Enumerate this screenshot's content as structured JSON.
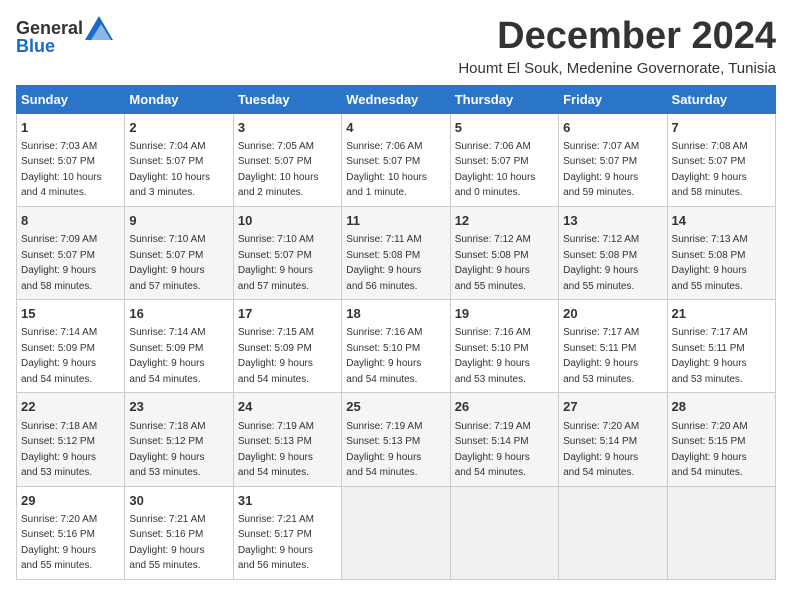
{
  "logo": {
    "general": "General",
    "blue": "Blue"
  },
  "title": "December 2024",
  "subtitle": "Houmt El Souk, Medenine Governorate, Tunisia",
  "days_of_week": [
    "Sunday",
    "Monday",
    "Tuesday",
    "Wednesday",
    "Thursday",
    "Friday",
    "Saturday"
  ],
  "weeks": [
    [
      {
        "num": "1",
        "sunrise": "7:03 AM",
        "sunset": "5:07 PM",
        "daylight": "10 hours and 4 minutes."
      },
      {
        "num": "2",
        "sunrise": "7:04 AM",
        "sunset": "5:07 PM",
        "daylight": "10 hours and 3 minutes."
      },
      {
        "num": "3",
        "sunrise": "7:05 AM",
        "sunset": "5:07 PM",
        "daylight": "10 hours and 2 minutes."
      },
      {
        "num": "4",
        "sunrise": "7:06 AM",
        "sunset": "5:07 PM",
        "daylight": "10 hours and 1 minute."
      },
      {
        "num": "5",
        "sunrise": "7:06 AM",
        "sunset": "5:07 PM",
        "daylight": "10 hours and 0 minutes."
      },
      {
        "num": "6",
        "sunrise": "7:07 AM",
        "sunset": "5:07 PM",
        "daylight": "9 hours and 59 minutes."
      },
      {
        "num": "7",
        "sunrise": "7:08 AM",
        "sunset": "5:07 PM",
        "daylight": "9 hours and 58 minutes."
      }
    ],
    [
      {
        "num": "8",
        "sunrise": "7:09 AM",
        "sunset": "5:07 PM",
        "daylight": "9 hours and 58 minutes."
      },
      {
        "num": "9",
        "sunrise": "7:10 AM",
        "sunset": "5:07 PM",
        "daylight": "9 hours and 57 minutes."
      },
      {
        "num": "10",
        "sunrise": "7:10 AM",
        "sunset": "5:07 PM",
        "daylight": "9 hours and 57 minutes."
      },
      {
        "num": "11",
        "sunrise": "7:11 AM",
        "sunset": "5:08 PM",
        "daylight": "9 hours and 56 minutes."
      },
      {
        "num": "12",
        "sunrise": "7:12 AM",
        "sunset": "5:08 PM",
        "daylight": "9 hours and 55 minutes."
      },
      {
        "num": "13",
        "sunrise": "7:12 AM",
        "sunset": "5:08 PM",
        "daylight": "9 hours and 55 minutes."
      },
      {
        "num": "14",
        "sunrise": "7:13 AM",
        "sunset": "5:08 PM",
        "daylight": "9 hours and 55 minutes."
      }
    ],
    [
      {
        "num": "15",
        "sunrise": "7:14 AM",
        "sunset": "5:09 PM",
        "daylight": "9 hours and 54 minutes."
      },
      {
        "num": "16",
        "sunrise": "7:14 AM",
        "sunset": "5:09 PM",
        "daylight": "9 hours and 54 minutes."
      },
      {
        "num": "17",
        "sunrise": "7:15 AM",
        "sunset": "5:09 PM",
        "daylight": "9 hours and 54 minutes."
      },
      {
        "num": "18",
        "sunrise": "7:16 AM",
        "sunset": "5:10 PM",
        "daylight": "9 hours and 54 minutes."
      },
      {
        "num": "19",
        "sunrise": "7:16 AM",
        "sunset": "5:10 PM",
        "daylight": "9 hours and 53 minutes."
      },
      {
        "num": "20",
        "sunrise": "7:17 AM",
        "sunset": "5:11 PM",
        "daylight": "9 hours and 53 minutes."
      },
      {
        "num": "21",
        "sunrise": "7:17 AM",
        "sunset": "5:11 PM",
        "daylight": "9 hours and 53 minutes."
      }
    ],
    [
      {
        "num": "22",
        "sunrise": "7:18 AM",
        "sunset": "5:12 PM",
        "daylight": "9 hours and 53 minutes."
      },
      {
        "num": "23",
        "sunrise": "7:18 AM",
        "sunset": "5:12 PM",
        "daylight": "9 hours and 53 minutes."
      },
      {
        "num": "24",
        "sunrise": "7:19 AM",
        "sunset": "5:13 PM",
        "daylight": "9 hours and 54 minutes."
      },
      {
        "num": "25",
        "sunrise": "7:19 AM",
        "sunset": "5:13 PM",
        "daylight": "9 hours and 54 minutes."
      },
      {
        "num": "26",
        "sunrise": "7:19 AM",
        "sunset": "5:14 PM",
        "daylight": "9 hours and 54 minutes."
      },
      {
        "num": "27",
        "sunrise": "7:20 AM",
        "sunset": "5:14 PM",
        "daylight": "9 hours and 54 minutes."
      },
      {
        "num": "28",
        "sunrise": "7:20 AM",
        "sunset": "5:15 PM",
        "daylight": "9 hours and 54 minutes."
      }
    ],
    [
      {
        "num": "29",
        "sunrise": "7:20 AM",
        "sunset": "5:16 PM",
        "daylight": "9 hours and 55 minutes."
      },
      {
        "num": "30",
        "sunrise": "7:21 AM",
        "sunset": "5:16 PM",
        "daylight": "9 hours and 55 minutes."
      },
      {
        "num": "31",
        "sunrise": "7:21 AM",
        "sunset": "5:17 PM",
        "daylight": "9 hours and 56 minutes."
      },
      null,
      null,
      null,
      null
    ]
  ]
}
